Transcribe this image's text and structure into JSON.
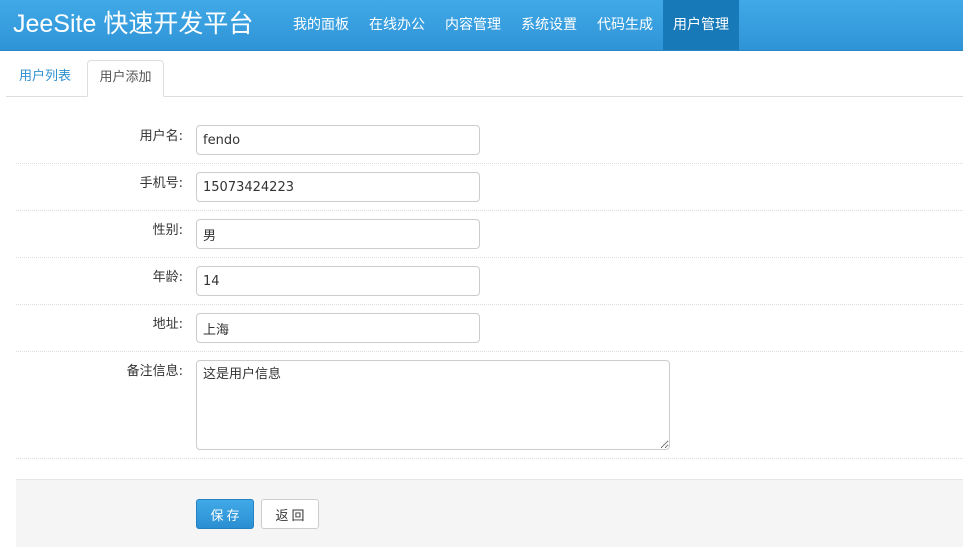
{
  "navbar": {
    "brand": "JeeSite 快速开发平台",
    "items": [
      "我的面板",
      "在线办公",
      "内容管理",
      "系统设置",
      "代码生成",
      "用户管理"
    ],
    "active_index": 5
  },
  "tabs": {
    "list_label": "用户列表",
    "add_label": "用户添加"
  },
  "form": {
    "username": {
      "label": "用户名:",
      "value": "fendo"
    },
    "phone": {
      "label": "手机号:",
      "value": "15073424223"
    },
    "gender": {
      "label": "性别:",
      "value": "男"
    },
    "age": {
      "label": "年龄:",
      "value": "14"
    },
    "address": {
      "label": "地址:",
      "value": "上海"
    },
    "remarks": {
      "label": "备注信息:",
      "value": "这是用户信息"
    }
  },
  "actions": {
    "save_label": "保存",
    "back_label": "返回"
  },
  "colors": {
    "navbar": "#3a9fe0",
    "nav_active": "#1779b7",
    "link": "#2f8fd0",
    "primary_button": "#3399dd"
  }
}
